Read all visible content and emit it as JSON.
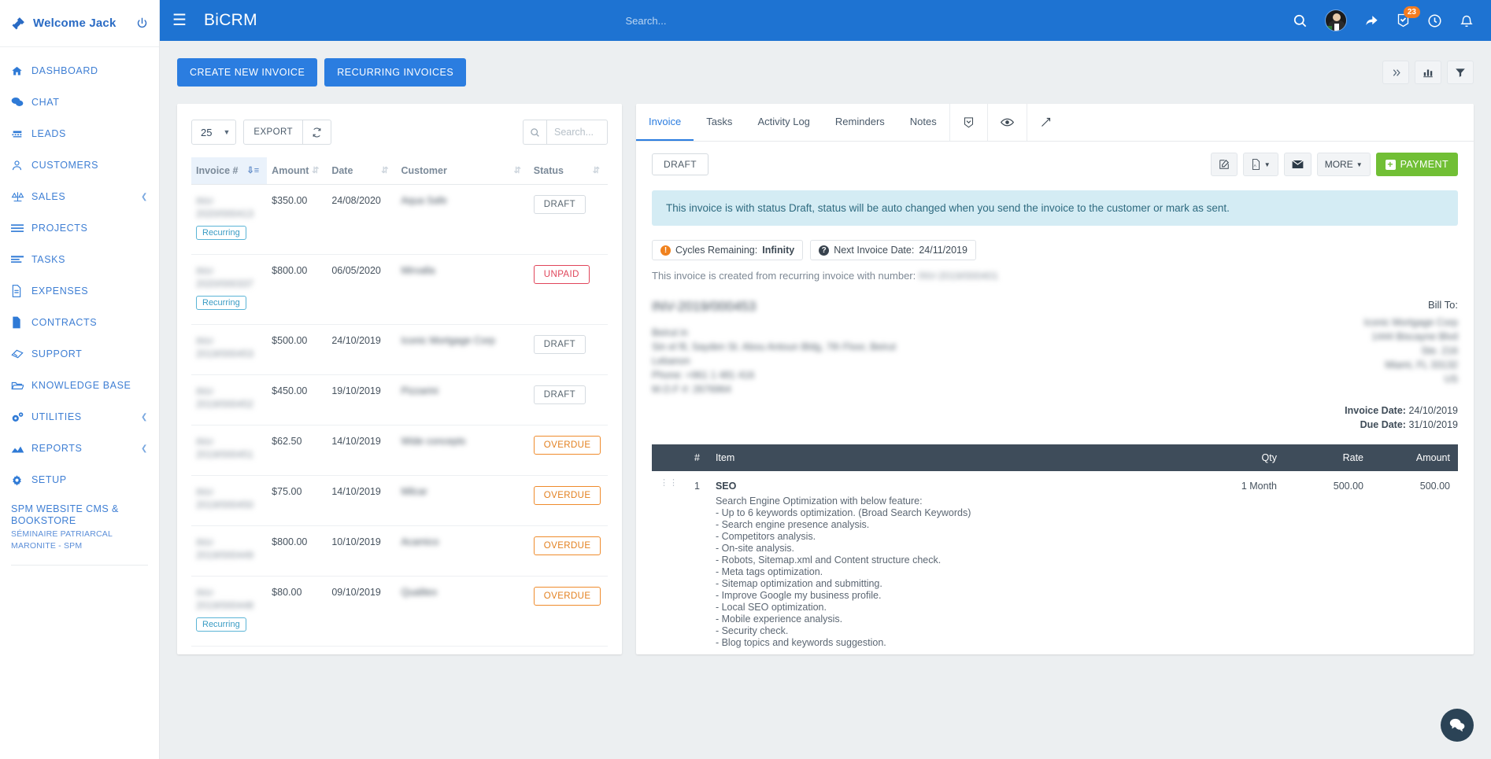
{
  "sidebar": {
    "welcome": "Welcome Jack",
    "items": [
      {
        "label": "DASHBOARD",
        "icon": "home-icon",
        "caret": false
      },
      {
        "label": "CHAT",
        "icon": "chat-icon",
        "caret": false
      },
      {
        "label": "LEADS",
        "icon": "leads-icon",
        "caret": false
      },
      {
        "label": "CUSTOMERS",
        "icon": "user-icon",
        "caret": false
      },
      {
        "label": "SALES",
        "icon": "scales-icon",
        "caret": true
      },
      {
        "label": "PROJECTS",
        "icon": "list-icon",
        "caret": false
      },
      {
        "label": "TASKS",
        "icon": "tasks-icon",
        "caret": false
      },
      {
        "label": "EXPENSES",
        "icon": "document-icon",
        "caret": false
      },
      {
        "label": "CONTRACTS",
        "icon": "file-icon",
        "caret": false
      },
      {
        "label": "SUPPORT",
        "icon": "ticket-icon",
        "caret": false
      },
      {
        "label": "KNOWLEDGE BASE",
        "icon": "folder-icon",
        "caret": false
      },
      {
        "label": "UTILITIES",
        "icon": "gears-icon",
        "caret": true
      },
      {
        "label": "REPORTS",
        "icon": "chart-icon",
        "caret": true
      },
      {
        "label": "SETUP",
        "icon": "gear-icon",
        "caret": false
      }
    ],
    "footer_primary": "SPM WEBSITE CMS & BOOKSTORE",
    "footer_secondary": "SÉMINAIRE PATRIARCAL MARONITE - SPM"
  },
  "topbar": {
    "brand": "BiCRM",
    "search_placeholder": "Search...",
    "search_value": "",
    "notification_count": "23"
  },
  "toolbar": {
    "create_invoice": "CREATE NEW INVOICE",
    "recurring_invoices": "RECURRING INVOICES"
  },
  "list": {
    "page_length": "25",
    "export_label": "EXPORT",
    "search_placeholder": "Search...",
    "search_value": "",
    "columns": [
      "Invoice #",
      "Amount",
      "Date",
      "Customer",
      "Status"
    ],
    "rows": [
      {
        "invoice_line1": "INV-",
        "invoice_line2": "2020/000413",
        "recurring": "Recurring",
        "amount": "$350.00",
        "date": "24/08/2020",
        "customer": "Aqua Safe",
        "status": "DRAFT",
        "status_kind": "draft"
      },
      {
        "invoice_line1": "INV-",
        "invoice_line2": "2020/000337",
        "recurring": "Recurring",
        "amount": "$800.00",
        "date": "06/05/2020",
        "customer": "Mirvalla",
        "status": "UNPAID",
        "status_kind": "unpaid"
      },
      {
        "invoice_line1": "INV-",
        "invoice_line2": "2019/000453",
        "recurring": "",
        "amount": "$500.00",
        "date": "24/10/2019",
        "customer": "Iconic Mortgage Corp",
        "status": "DRAFT",
        "status_kind": "draft"
      },
      {
        "invoice_line1": "INV-",
        "invoice_line2": "2019/000452",
        "recurring": "",
        "amount": "$450.00",
        "date": "19/10/2019",
        "customer": "Pizzarini",
        "status": "DRAFT",
        "status_kind": "draft"
      },
      {
        "invoice_line1": "INV-",
        "invoice_line2": "2019/000451",
        "recurring": "",
        "amount": "$62.50",
        "date": "14/10/2019",
        "customer": "Wide concepts",
        "status": "OVERDUE",
        "status_kind": "overdue"
      },
      {
        "invoice_line1": "INV-",
        "invoice_line2": "2019/000450",
        "recurring": "",
        "amount": "$75.00",
        "date": "14/10/2019",
        "customer": "Milcar",
        "status": "OVERDUE",
        "status_kind": "overdue"
      },
      {
        "invoice_line1": "INV-",
        "invoice_line2": "2019/000449",
        "recurring": "",
        "amount": "$800.00",
        "date": "10/10/2019",
        "customer": "Acamico",
        "status": "OVERDUE",
        "status_kind": "overdue"
      },
      {
        "invoice_line1": "INV-",
        "invoice_line2": "2019/000448",
        "recurring": "Recurring",
        "amount": "$80.00",
        "date": "09/10/2019",
        "customer": "Qualitex",
        "status": "OVERDUE",
        "status_kind": "overdue"
      }
    ]
  },
  "detail": {
    "tabs": [
      {
        "label": "Invoice",
        "active": true
      },
      {
        "label": "Tasks",
        "active": false
      },
      {
        "label": "Activity Log",
        "active": false
      },
      {
        "label": "Reminders",
        "active": false
      },
      {
        "label": "Notes",
        "active": false
      }
    ],
    "status_chip": "DRAFT",
    "more_label": "MORE",
    "payment_label": "PAYMENT",
    "alert": "This invoice is with status Draft, status will be auto changed when you send the invoice to the customer or mark as sent.",
    "chip_cycles_label": "Cycles Remaining:",
    "chip_cycles_value": "Infinity",
    "chip_next_label": "Next Invoice Date:",
    "chip_next_value": "24/11/2019",
    "recurring_from_label": "This invoice is created from recurring invoice with number:",
    "recurring_from_value": "INV-2019/000401",
    "invoice_number": "INV-2019/000453",
    "from_address": [
      "Beirut in",
      "Sin el fil, Sayden St. Abou Antoun Bldg, 7th Floor, Beirut",
      "Lebanon",
      "Phone: +961 1 481 416",
      "M.O.F #: 2676964"
    ],
    "bill_to_label": "Bill To:",
    "bill_to": [
      "Iconic Mortgage Corp",
      "1444 Biscayne Blvd",
      "Ste. 216",
      "Miami, FL 33132",
      "US"
    ],
    "invoice_date_label": "Invoice Date:",
    "invoice_date_value": "24/10/2019",
    "due_date_label": "Due Date:",
    "due_date_value": "31/10/2019",
    "item_columns": [
      "#",
      "Item",
      "Qty",
      "Rate",
      "Amount"
    ],
    "items": [
      {
        "index": "1",
        "name": "SEO",
        "description": [
          "Search Engine Optimization with below feature:",
          "- Up to 6 keywords optimization. (Broad Search Keywords)",
          "- Search engine presence analysis.",
          "- Competitors analysis.",
          "- On-site analysis.",
          "- Robots, Sitemap.xml and Content structure check.",
          "- Meta tags optimization.",
          "- Sitemap optimization and submitting.",
          "- Improve Google my business profile.",
          "- Local SEO optimization.",
          "- Mobile experience analysis.",
          "- Security check.",
          "- Blog topics and keywords suggestion."
        ],
        "qty": "1 Month",
        "rate": "500.00",
        "amount": "500.00"
      }
    ]
  },
  "colors": {
    "brand_blue": "#1e73d2",
    "accent_blue": "#2b7de0",
    "payment_green": "#71bf35",
    "status_unpaid": "#e0455a",
    "status_overdue": "#e3801f",
    "badge_orange": "#f57c20",
    "alert_bg": "#d4ecf4",
    "table_header_dark": "#3e4c5a"
  }
}
